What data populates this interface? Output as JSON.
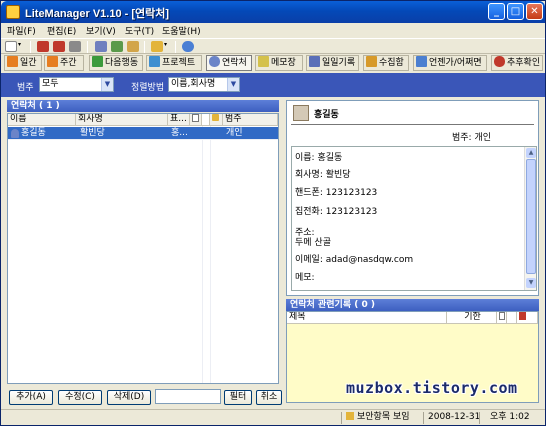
{
  "window": {
    "title": "LiteManager V1.10 - [연락처]"
  },
  "menu": [
    "파일(F)",
    "편집(E)",
    "보기(V)",
    "도구(T)",
    "도움말(H)"
  ],
  "toolbar2": {
    "buttons": [
      "일간",
      "주간",
      "다음행동",
      "프로젝트",
      "연락처",
      "메모장",
      "일일기록",
      "수집함",
      "언젠가/어쩌면",
      "추후확인"
    ],
    "active": "연락처"
  },
  "filter": {
    "category_label": "범주",
    "category_value": "모두",
    "sort_label": "정렬방법",
    "sort_value": "이름,회사명"
  },
  "contact_list": {
    "header": "연락처 ( 1 )",
    "columns": [
      "이름",
      "회사명",
      "표...",
      "범주"
    ],
    "rows": [
      {
        "name": "홍길동",
        "company": "활빈당",
        "extra": "홍...",
        "category": "개인"
      }
    ]
  },
  "buttons": {
    "add": "추가(A)",
    "edit": "수정(C)",
    "delete": "삭제(D)",
    "filter": "필터",
    "cancel": "취소"
  },
  "detail": {
    "name": "홍길동",
    "category_line": "범주:   개인",
    "lines": [
      "이름:     홍길동",
      "회사명:    활빈당",
      "핸드폰:    123123123",
      "집전화:    123123123",
      "주소:",
      "두메 산골",
      "이메일:    adad@nasdqw.com",
      "메모:"
    ]
  },
  "related": {
    "header": "연락처 관련기록 ( 0 )",
    "columns": [
      "제목",
      "기한"
    ]
  },
  "watermark": "muzbox.tistory.com",
  "status": {
    "security": "보안항목 보임",
    "date": "2008-12-31",
    "time": "오후 1:02"
  }
}
